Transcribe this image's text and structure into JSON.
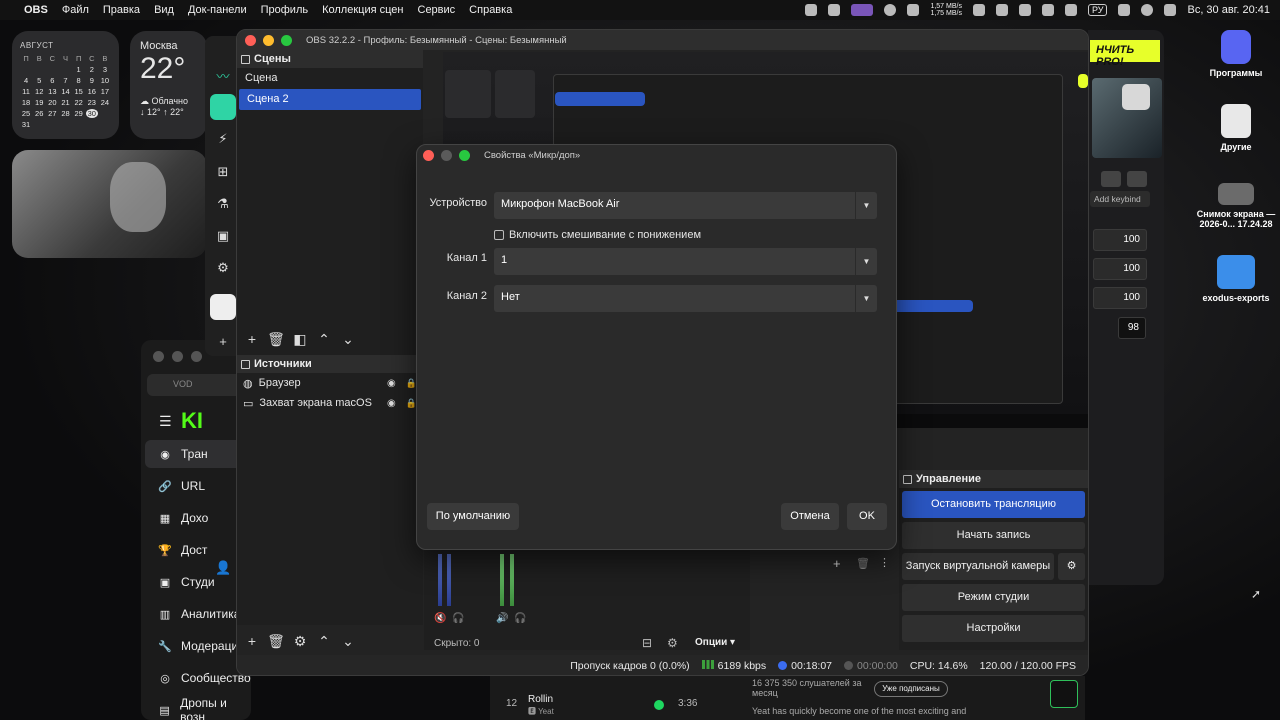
{
  "menubar": {
    "app": "OBS",
    "items": [
      "Файл",
      "Правка",
      "Вид",
      "Док-панели",
      "Профиль",
      "Коллекция сцен",
      "Сервис",
      "Справка"
    ],
    "net_up": "1,57 MB/s",
    "net_down": "1,75 MB/s",
    "input_lang": "РУ",
    "clock": "Вс, 30 авг.  20:41"
  },
  "widgets": {
    "calendar": {
      "month": "АВГУСТ",
      "weekdays": [
        "П",
        "В",
        "С",
        "Ч",
        "П",
        "С",
        "В"
      ],
      "days": [
        "",
        "",
        "",
        "",
        "1",
        "2",
        "3",
        "4",
        "5",
        "6",
        "7",
        "8",
        "9",
        "10",
        "11",
        "12",
        "13",
        "14",
        "15",
        "16",
        "17",
        "18",
        "19",
        "20",
        "21",
        "22",
        "23",
        "24",
        "25",
        "26",
        "27",
        "28",
        "29",
        "30",
        "",
        "31"
      ],
      "today": "30"
    },
    "weather": {
      "city": "Москва",
      "temp": "22°",
      "condition": "Облачно",
      "range": "↓ 12° ↑ 22°"
    }
  },
  "desktop": {
    "items": [
      {
        "label": "Программы"
      },
      {
        "label": "Другие"
      },
      {
        "label": "Снимок экрана — 2026-0... 17.24.28"
      },
      {
        "label": "exodus-exports"
      }
    ]
  },
  "right_app": {
    "promo": "НЧИТЬ PRO!",
    "keybind": "Add keybind",
    "values": [
      "100",
      "100",
      "100",
      "98"
    ]
  },
  "browser_bg": {
    "tab": "VOD",
    "logo": "KI",
    "nav": [
      {
        "icon": "◉",
        "label": "Тран"
      },
      {
        "icon": "🔗",
        "label": "URL"
      },
      {
        "icon": "▦",
        "label": "Дохо"
      },
      {
        "icon": "🏆",
        "label": "Дост"
      },
      {
        "icon": "▣",
        "label": "Студи"
      },
      {
        "icon": "▥",
        "label": "Аналитика"
      },
      {
        "icon": "🔧",
        "label": "Модерация"
      },
      {
        "icon": "◎",
        "label": "Сообщество"
      },
      {
        "icon": "▤",
        "label": "Дропы и возн"
      }
    ]
  },
  "obs": {
    "title": "OBS 32.2.2 - Профиль: Безымянный - Сцены: Безымянный",
    "scenes": {
      "header": "Сцены",
      "items": [
        {
          "label": "Сцена",
          "selected": false
        },
        {
          "label": "Сцена 2",
          "selected": true
        }
      ]
    },
    "sources": {
      "header": "Источники",
      "items": [
        {
          "label": "Браузер",
          "icon": "globe-icon"
        },
        {
          "label": "Захват экрана macOS",
          "icon": "monitor-icon"
        }
      ]
    },
    "mixer": {
      "hidden": "Скрыто: 0",
      "options": "Опции"
    },
    "controls": {
      "header": "Управление",
      "buttons": [
        "Остановить трансляцию",
        "Начать запись",
        "Запуск виртуальной камеры",
        "Режим студии",
        "Настройки"
      ]
    },
    "status": {
      "dropped": "Пропуск кадров 0 (0.0%)",
      "bitrate": "6189 kbps",
      "stream_time": "00:18:07",
      "rec_time": "00:00:00",
      "cpu": "CPU: 14.6%",
      "fps": "120.00 / 120.00 FPS"
    }
  },
  "dialog": {
    "title": "Свойства «Микр/доп»",
    "device_label": "Устройство",
    "device_value": "Микрофон MacBook Air",
    "ducking_label": "Включить смешивание с понижением",
    "ducking_checked": false,
    "channel1_label": "Канал 1",
    "channel1_value": "1",
    "channel2_label": "Канал 2",
    "channel2_value": "Нет",
    "defaults_button": "По умолчанию",
    "cancel_button": "Отмена",
    "ok_button": "OK"
  },
  "music": {
    "track_no": "12",
    "track": "Rollin",
    "artist": "Yeat",
    "duration": "3:36",
    "listeners": "16 375 350 слушателей за месяц",
    "subscribed": "Уже подписаны",
    "bio": "Yeat has quickly become one of the most exciting and"
  },
  "colors": {
    "accent": "#2a55c0",
    "kick_green": "#53fc18",
    "promo_yellow": "#e7ff2a"
  }
}
